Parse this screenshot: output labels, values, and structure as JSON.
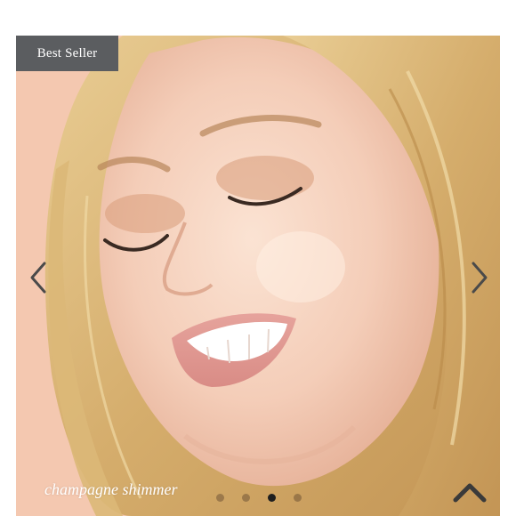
{
  "badge": {
    "label": "Best Seller"
  },
  "slide": {
    "caption": "champagne shimmer"
  },
  "carousel": {
    "slides_count": 4,
    "active_index": 2
  },
  "icons": {
    "prev": "chevron-left-icon",
    "next": "chevron-right-icon",
    "scroll_top": "chevron-up-icon"
  },
  "colors": {
    "badge_bg": "#5b5d60",
    "background": "#f3c9b2",
    "dot_active": "#1e1e1e"
  }
}
